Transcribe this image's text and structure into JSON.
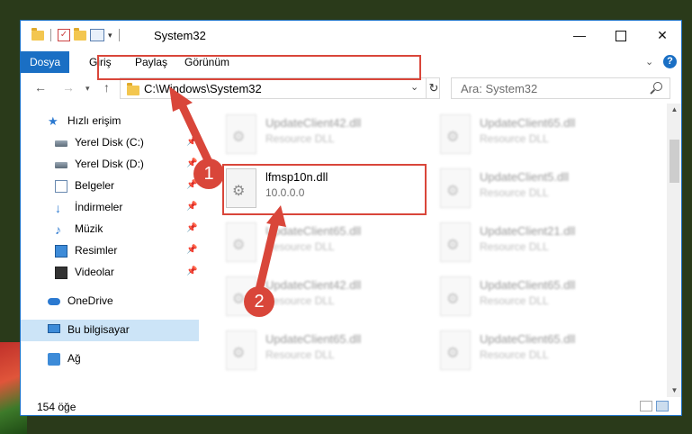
{
  "window": {
    "title": "System32",
    "min_glyph": "—",
    "close_glyph": "✕"
  },
  "ribbon": {
    "tabs": [
      "Dosya",
      "Giriş",
      "Paylaş",
      "Görünüm"
    ],
    "help": "?"
  },
  "address": {
    "path": "C:\\Windows\\System32",
    "search_placeholder": "Ara: System32"
  },
  "sidebar": {
    "items": [
      {
        "label": "Hızlı erişim",
        "icon": "star-icon"
      },
      {
        "label": "Yerel Disk (C:)",
        "icon": "drive-icon"
      },
      {
        "label": "Yerel Disk (D:)",
        "icon": "drive-icon"
      },
      {
        "label": "Belgeler",
        "icon": "documents-icon"
      },
      {
        "label": "İndirmeler",
        "icon": "downloads-icon"
      },
      {
        "label": "Müzik",
        "icon": "music-icon"
      },
      {
        "label": "Resimler",
        "icon": "pictures-icon"
      },
      {
        "label": "Videolar",
        "icon": "videos-icon"
      },
      {
        "label": "OneDrive",
        "icon": "onedrive-icon"
      },
      {
        "label": "Bu bilgisayar",
        "icon": "this-pc-icon"
      },
      {
        "label": "Ağ",
        "icon": "network-icon"
      }
    ]
  },
  "files": {
    "left": [
      {
        "name": "UpdateClient42.dll",
        "desc": "Resource DLL"
      },
      {
        "name": "lfmsp10n.dll",
        "desc": "10.0.0.0"
      },
      {
        "name": "UpdateClient65.dll",
        "desc": "Resource DLL"
      },
      {
        "name": "UpdateClient42.dll",
        "desc": "Resource DLL"
      },
      {
        "name": "UpdateClient65.dll",
        "desc": "Resource DLL"
      }
    ],
    "right": [
      {
        "name": "UpdateClient65.dll",
        "desc": "Resource DLL"
      },
      {
        "name": "UpdateClient5.dll",
        "desc": "Resource DLL"
      },
      {
        "name": "UpdateClient21.dll",
        "desc": "Resource DLL"
      },
      {
        "name": "UpdateClient65.dll",
        "desc": "Resource DLL"
      },
      {
        "name": "UpdateClient65.dll",
        "desc": "Resource DLL"
      }
    ]
  },
  "status": {
    "count": "154 öğe"
  },
  "annotations": {
    "step1": "1",
    "step2": "2",
    "highlight_color": "#d9463a"
  }
}
